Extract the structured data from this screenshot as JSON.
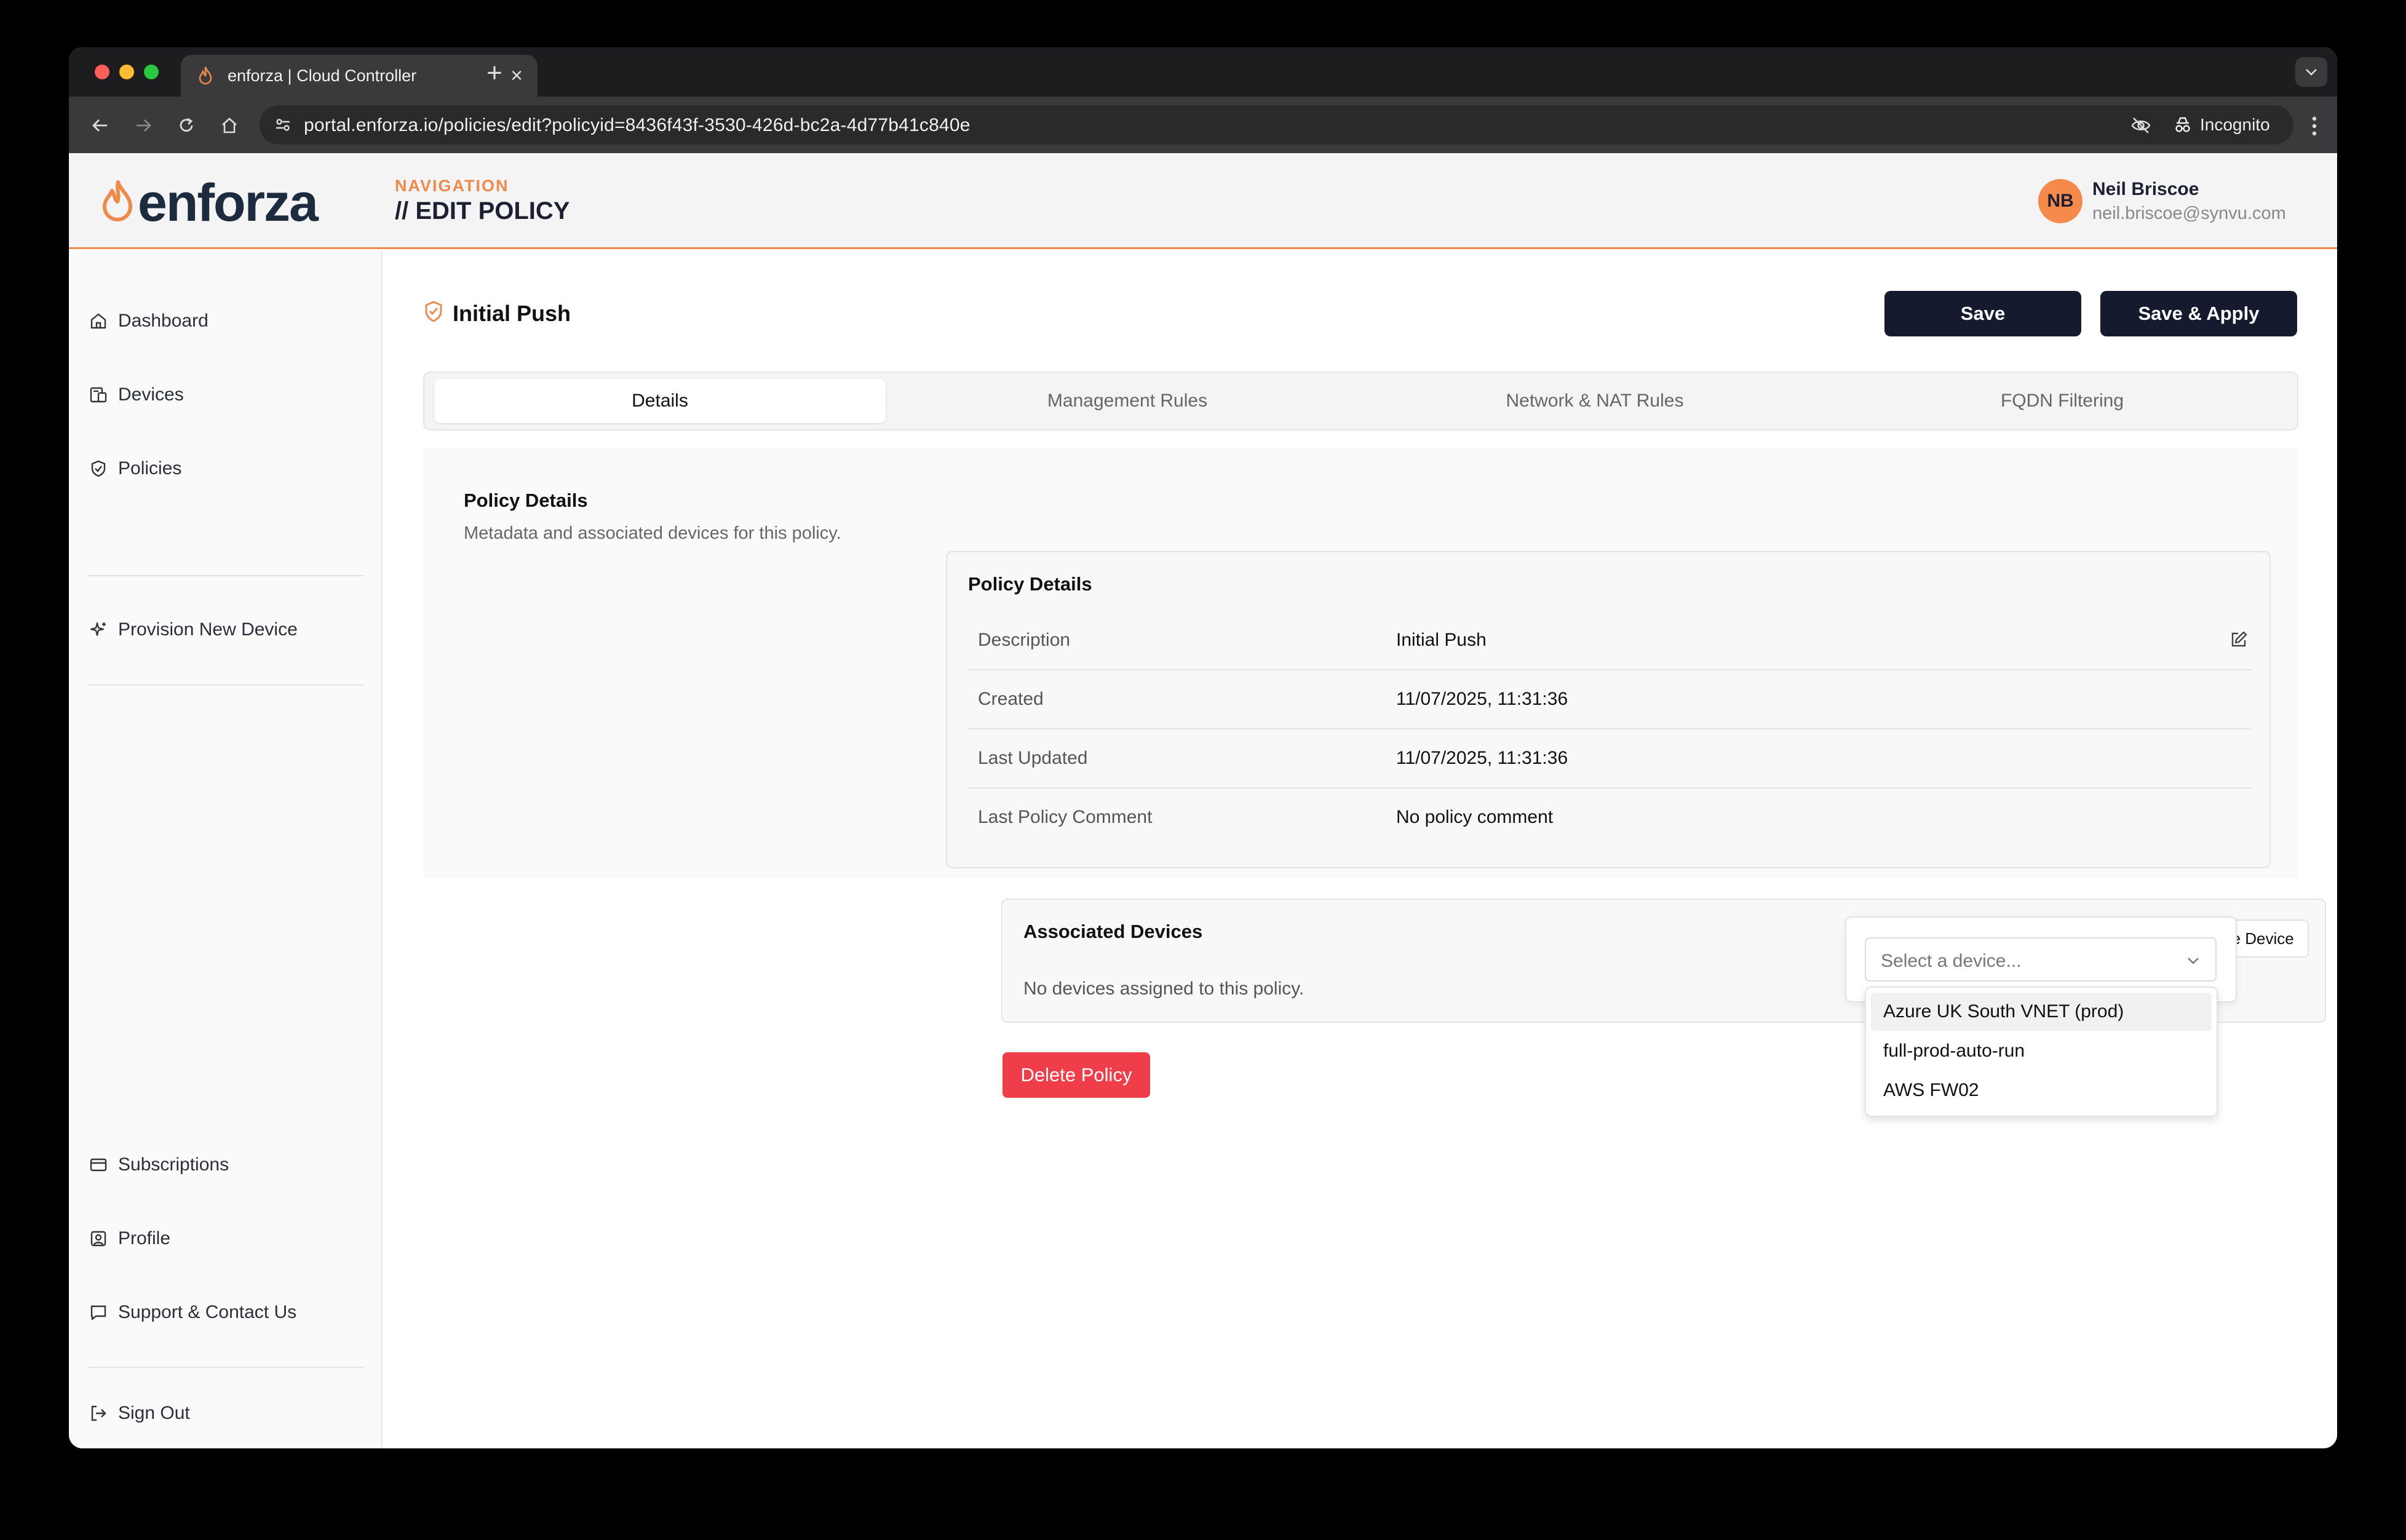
{
  "browser": {
    "tab_title": "enforza | Cloud Controller",
    "url": "portal.enforza.io/policies/edit?policyid=8436f43f-3530-426d-bc2a-4d77b41c840e",
    "incognito_label": "Incognito"
  },
  "header": {
    "brand": "enforza",
    "nav_label": "NAVIGATION",
    "page_title": "// EDIT POLICY",
    "user": {
      "initials": "NB",
      "name": "Neil Briscoe",
      "email": "neil.briscoe@synvu.com"
    }
  },
  "sidebar": {
    "items": [
      {
        "label": "Dashboard",
        "icon": "home-icon"
      },
      {
        "label": "Devices",
        "icon": "devices-icon"
      },
      {
        "label": "Policies",
        "icon": "shield-icon"
      },
      {
        "label": "Provision New Device",
        "icon": "sparkle-icon"
      },
      {
        "label": "Subscriptions",
        "icon": "credit-card-icon"
      },
      {
        "label": "Profile",
        "icon": "profile-icon"
      },
      {
        "label": "Support & Contact Us",
        "icon": "chat-icon"
      },
      {
        "label": "Sign Out",
        "icon": "sign-out-icon"
      }
    ]
  },
  "main": {
    "policy_name": "Initial Push",
    "save_label": "Save",
    "save_apply_label": "Save & Apply",
    "tabs": [
      {
        "label": "Details",
        "active": true
      },
      {
        "label": "Management Rules",
        "active": false
      },
      {
        "label": "Network & NAT Rules",
        "active": false
      },
      {
        "label": "FQDN Filtering",
        "active": false
      }
    ],
    "section": {
      "title": "Policy Details",
      "subtitle": "Metadata and associated devices for this policy."
    },
    "details_card": {
      "title": "Policy Details",
      "rows": [
        {
          "key": "Description",
          "value": "Initial Push"
        },
        {
          "key": "Created",
          "value": "11/07/2025, 11:31:36"
        },
        {
          "key": "Last Updated",
          "value": "11/07/2025, 11:31:36"
        },
        {
          "key": "Last Policy Comment",
          "value": "No policy comment"
        }
      ]
    },
    "devices_card": {
      "title": "Associated Devices",
      "associate_label": "Associate Device",
      "empty_text": "No devices assigned to this policy."
    },
    "delete_label": "Delete Policy",
    "device_select": {
      "placeholder": "Select a device...",
      "options": [
        "Azure UK South VNET (prod)",
        "full-prod-auto-run",
        "AWS FW02"
      ],
      "highlighted_index": 0
    }
  },
  "colors": {
    "accent": "#f08a4b",
    "primary_button": "#151a2e",
    "danger": "#ef3e4a"
  }
}
